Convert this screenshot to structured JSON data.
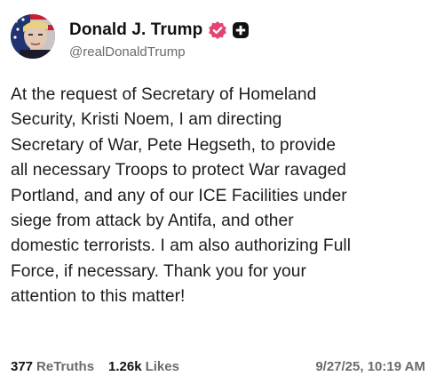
{
  "post": {
    "author": {
      "display_name": "Donald J. Trump",
      "handle": "@realDonaldTrump",
      "verified": true
    },
    "body_lines": [
      "At the request of Secretary of Homeland",
      "Security, Kristi Noem, I am directing",
      "Secretary of War, Pete Hegseth, to provide",
      "all necessary Troops to protect War ravaged",
      "Portland, and any of our ICE Facilities under",
      "siege from attack by Antifa, and other",
      "domestic terrorists. I am also authorizing Full",
      "Force, if necessary. Thank you for your",
      "attention to this matter!"
    ],
    "stats": {
      "retruths_count": "377",
      "retruths_label": "ReTruths",
      "likes_count": "1.26k",
      "likes_label": "Likes"
    },
    "timestamp": "9/27/25, 10:19 AM"
  },
  "icons": {
    "verified": "verified-badge-icon",
    "plus_badge": "plus-badge-icon"
  },
  "colors": {
    "verified_badge": "#e2456f",
    "plus_badge": "#111111",
    "secondary_text": "#6b6b6b"
  }
}
